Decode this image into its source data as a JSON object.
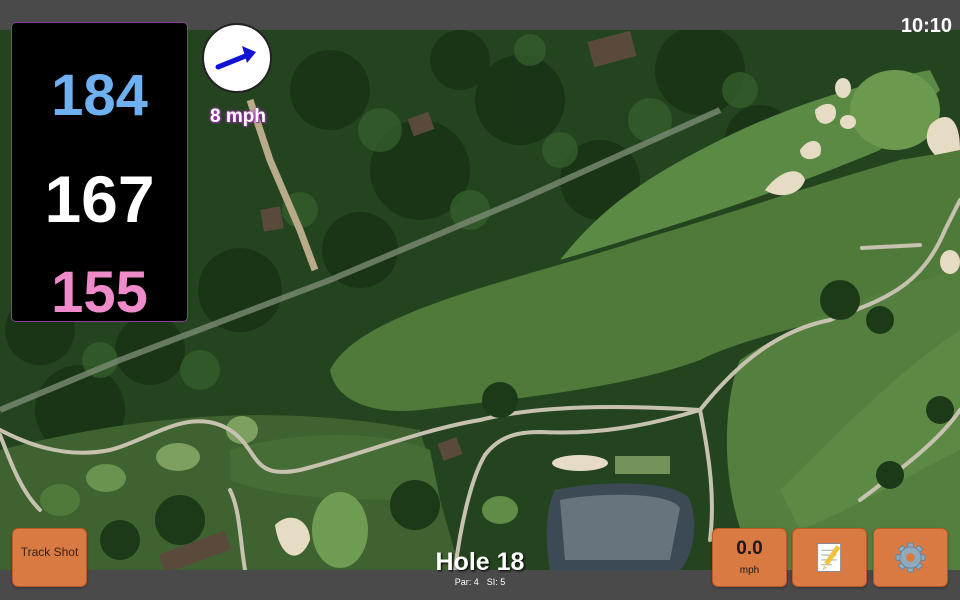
{
  "status": {
    "time": "10:10"
  },
  "distances": {
    "back": "184",
    "middle": "167",
    "front": "155",
    "colors": {
      "back": "#6fb0f0",
      "middle": "#ffffff",
      "front": "#f08bcb"
    }
  },
  "wind": {
    "speed": "8 mph",
    "direction_icon": "arrow-icon"
  },
  "hole": {
    "title": "Hole 18",
    "par": "Par: 4",
    "si": "SI: 5"
  },
  "buttons": {
    "track_shot": "Track Shot",
    "speed_value": "0.0",
    "speed_unit": "mph",
    "notes_icon": "notepad-icon",
    "settings_icon": "gear-icon",
    "accent": "#d87a42"
  }
}
